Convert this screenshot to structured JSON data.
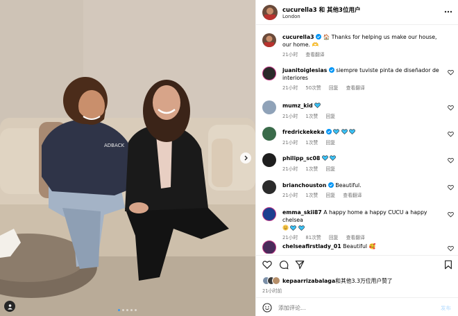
{
  "post": {
    "header": {
      "title": "cucurella3 和 其他3位用户",
      "location": "London"
    },
    "caption": {
      "username": "cucurella3",
      "text": "🏠 Thanks for helping us make our house, our home. 🫶",
      "time": "21小时",
      "translate": "查看翻译"
    }
  },
  "comments": [
    {
      "username": "juanitoiglesias",
      "verified": true,
      "text": "siempre tuviste pinta de diseñador de interiores",
      "time": "21小时",
      "likes": "50次赞",
      "reply": "回复",
      "translate": "查看翻译"
    },
    {
      "username": "mumz_kid",
      "verified": false,
      "text": "",
      "hearts": 1,
      "time": "21小时",
      "likes": "1次赞",
      "reply": "回复"
    },
    {
      "username": "fredrickekeka",
      "verified": true,
      "text": "",
      "hearts": 3,
      "time": "21小时",
      "likes": "1次赞",
      "reply": "回复"
    },
    {
      "username": "philipp_sc08",
      "verified": false,
      "text": "",
      "hearts": 2,
      "time": "21小时",
      "likes": "1次赞",
      "reply": "回复"
    },
    {
      "username": "brianchouston",
      "verified": true,
      "text": "Beautiful.",
      "time": "21小时",
      "likes": "1次赞",
      "reply": "回复",
      "translate": "查看翻译"
    },
    {
      "username": "emma_skii87",
      "verified": false,
      "text": "A happy home a happy CUCU a happy chelsea",
      "time": "21小时",
      "likes": "81次赞",
      "reply": "回复",
      "translate": "查看翻译"
    },
    {
      "username": "chelseafirstlady_01",
      "verified": false,
      "text": "Beautiful 🥰"
    }
  ],
  "likes_summary": {
    "username": "kepaarrizabalaga",
    "text": "和其他3.3万位用户赞了"
  },
  "post_time": "21小时前",
  "add_comment": {
    "placeholder": "添加评论...",
    "post_label": "发布"
  },
  "carousel": {
    "total": 5,
    "active_index": 0
  },
  "colors": {
    "verified": "#0095f6",
    "blue_heart": "#3cc1f5",
    "post_disabled": "#b3dbff",
    "secondary_text": "#737373"
  },
  "icons": [
    "more-icon",
    "heart-icon",
    "comment-icon",
    "share-icon",
    "bookmark-icon",
    "emoji-icon",
    "chevron-right-icon",
    "user-tag-icon",
    "verified-icon"
  ]
}
